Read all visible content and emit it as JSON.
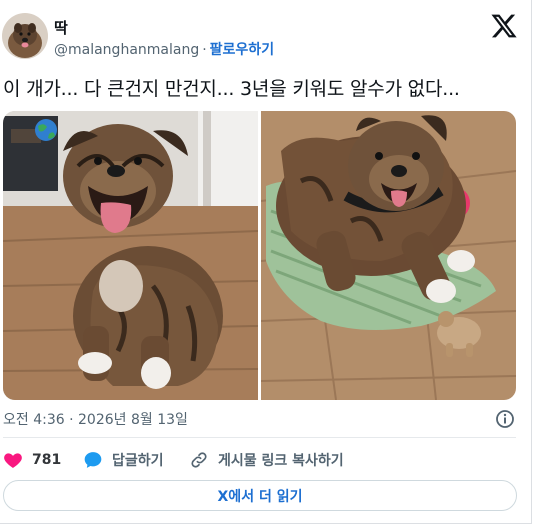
{
  "author": {
    "display_name": "딱",
    "handle": "@malanghanmalang",
    "separator": "·",
    "follow_label": "팔로우하기"
  },
  "tweet": {
    "text": "이 개가... 다 큰건지 만건지... 3년을 키워도 알수가 없다...",
    "timestamp": "오전 4:36 · 2026년 8월 13일"
  },
  "actions": {
    "like_count": "781",
    "reply_label": "답글하기",
    "copy_link_label": "게시물 링크 복사하기"
  },
  "read_more_label": "X에서 더 읽기",
  "icons": {
    "logo": "x-logo-icon",
    "info": "info-icon",
    "like": "heart-icon",
    "reply": "speech-bubble-icon",
    "link": "link-icon",
    "badge": "globe-emoji-icon"
  },
  "colors": {
    "link_blue": "#1d6fd1",
    "like_red": "#f91880",
    "reply_blue": "#1d9bf0",
    "muted_text": "#536471"
  }
}
